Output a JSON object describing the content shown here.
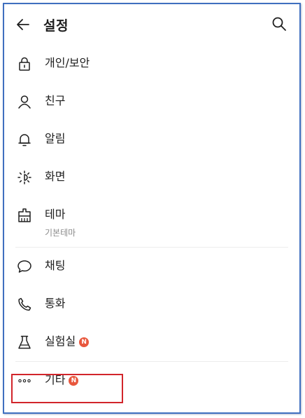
{
  "header": {
    "title": "설정",
    "back_icon": "arrow-left-icon",
    "search_icon": "search-icon"
  },
  "menu": [
    {
      "label": "개인/보안",
      "icon": "lock-icon"
    },
    {
      "label": "친구",
      "icon": "person-icon"
    },
    {
      "label": "알림",
      "icon": "bell-icon"
    },
    {
      "label": "화면",
      "icon": "brightness-icon"
    },
    {
      "label": "테마",
      "sublabel": "기본테마",
      "icon": "theme-icon"
    },
    {
      "label": "채팅",
      "icon": "chat-bubble-icon"
    },
    {
      "label": "통화",
      "icon": "phone-icon"
    },
    {
      "label": "실험실",
      "icon": "flask-icon",
      "badge": "N"
    },
    {
      "label": "기타",
      "icon": "more-icon",
      "badge": "N"
    }
  ],
  "colors": {
    "badge": "#e8573d",
    "highlight_box": "#d2252b",
    "frame_border": "#3f6fbf"
  }
}
